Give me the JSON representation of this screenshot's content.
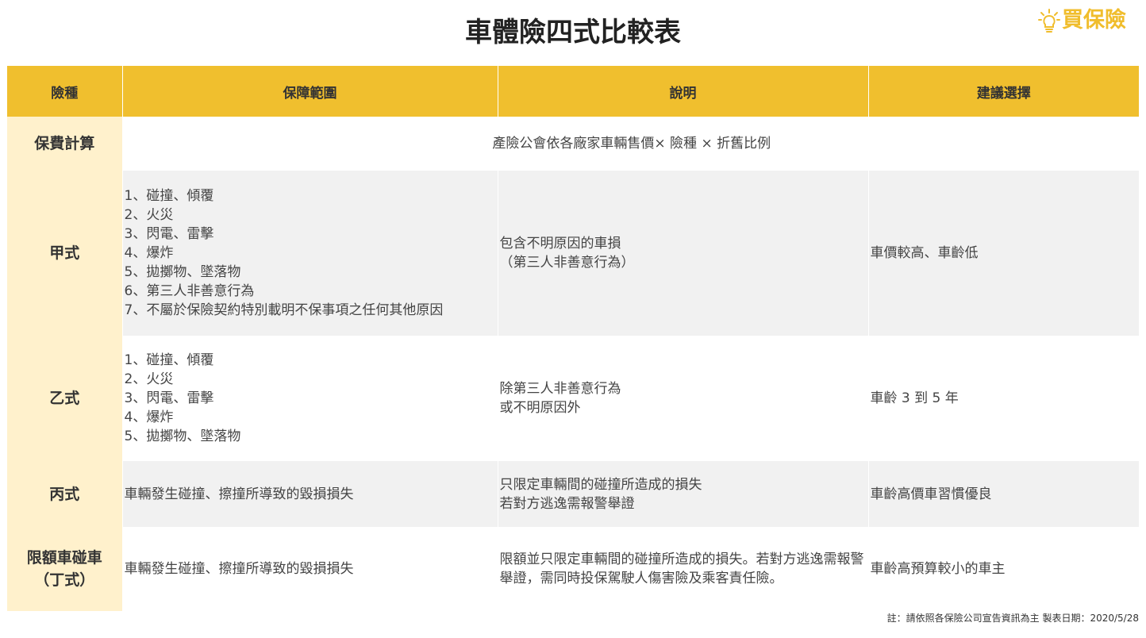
{
  "title": "車體險四式比較表",
  "logo": {
    "text": "買保險",
    "icon": "lightbulb-icon",
    "color": "#F0BD2C"
  },
  "colors": {
    "header": "#F0BF2E",
    "label_cell": "#FFF1CC",
    "row_gray": "#F1F1F1"
  },
  "table": {
    "headers": [
      "險種",
      "保障範圍",
      "說明",
      "建議選擇"
    ],
    "premium_row": {
      "label": "保費計算",
      "content": "產險公會依各廠家車輛售價× 險種 × 折舊比例"
    },
    "rows": [
      {
        "label": [
          "甲式"
        ],
        "coverage": [
          "1、碰撞、傾覆",
          "2、火災",
          "3、閃電、雷擊",
          "4、爆炸",
          "5、拋擲物、墜落物",
          "6、第三人非善意行為",
          "7、不屬於保險契約特別載明不保事項之任何其他原因"
        ],
        "description": [
          "包含不明原因的車損",
          "（第三人非善意行為）"
        ],
        "recommendation": "車價較高、車齡低"
      },
      {
        "label": [
          "乙式"
        ],
        "coverage": [
          "1、碰撞、傾覆",
          "2、火災",
          "3、閃電、雷擊",
          "4、爆炸",
          "5、拋擲物、墜落物"
        ],
        "description": [
          "除第三人非善意行為",
          "或不明原因外"
        ],
        "recommendation": "車齡 3 到 5 年"
      },
      {
        "label": [
          "丙式"
        ],
        "coverage": [
          "車輛發生碰撞、擦撞所導致的毀損損失"
        ],
        "description": [
          "只限定車輛間的碰撞所造成的損失",
          "若對方逃逸需報警舉證"
        ],
        "recommendation": "車齡高價車習慣優良"
      },
      {
        "label": [
          "限額車碰車",
          "（丁式）"
        ],
        "coverage": [
          "車輛發生碰撞、擦撞所導致的毀損損失"
        ],
        "description": [
          "限額並只限定車輛間的碰撞所造成的損失。若對方逃逸需報警舉證，需同時投保駕駛人傷害險及乘客責任險。"
        ],
        "recommendation": "車齡高預算較小的車主"
      }
    ]
  },
  "footnote": "註：請依照各保險公司宣告資訊為主  製表日期：2020/5/28"
}
